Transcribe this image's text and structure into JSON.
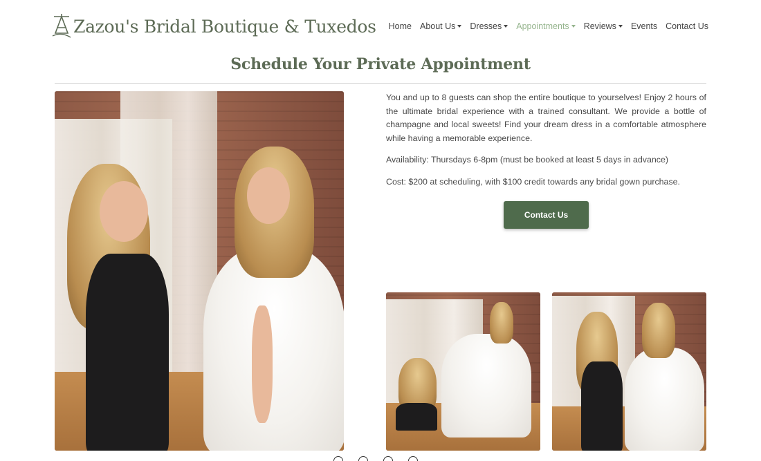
{
  "header": {
    "logo_text": "Zazou's Bridal Boutique & Tuxedos",
    "logo_icon": "dress-hanger-icon",
    "brand_color": "#5d6b56"
  },
  "nav": {
    "items": [
      {
        "label": "Home",
        "has_dropdown": false,
        "active": false
      },
      {
        "label": "About Us",
        "has_dropdown": true,
        "active": false
      },
      {
        "label": "Dresses",
        "has_dropdown": true,
        "active": false
      },
      {
        "label": "Appointments",
        "has_dropdown": true,
        "active": true
      },
      {
        "label": "Reviews",
        "has_dropdown": true,
        "active": false
      },
      {
        "label": "Events",
        "has_dropdown": false,
        "active": false
      },
      {
        "label": "Contact Us",
        "has_dropdown": false,
        "active": false
      }
    ],
    "active_color": "#96b58e"
  },
  "main": {
    "title": "Schedule Your Private Appointment",
    "paragraphs": [
      "You and up to 8 guests can shop the entire boutique to yourselves! Enjoy 2 hours of the ultimate bridal experience with a trained consultant. We provide a bottle of champagne and local sweets! Find your dream dress in a comfortable atmosphere while having a memorable experience.",
      "Availability: Thursdays 6-8pm (must be booked at least 5 days in advance)",
      "Cost: $200 at scheduling, with $100 credit towards any bridal gown purchase."
    ],
    "contact_button": "Contact Us",
    "button_color": "#4f6b4c"
  },
  "images": [
    {
      "name": "main-photo"
    },
    {
      "name": "photo-small-1"
    },
    {
      "name": "photo-small-2"
    }
  ],
  "carousel_dots": 4
}
